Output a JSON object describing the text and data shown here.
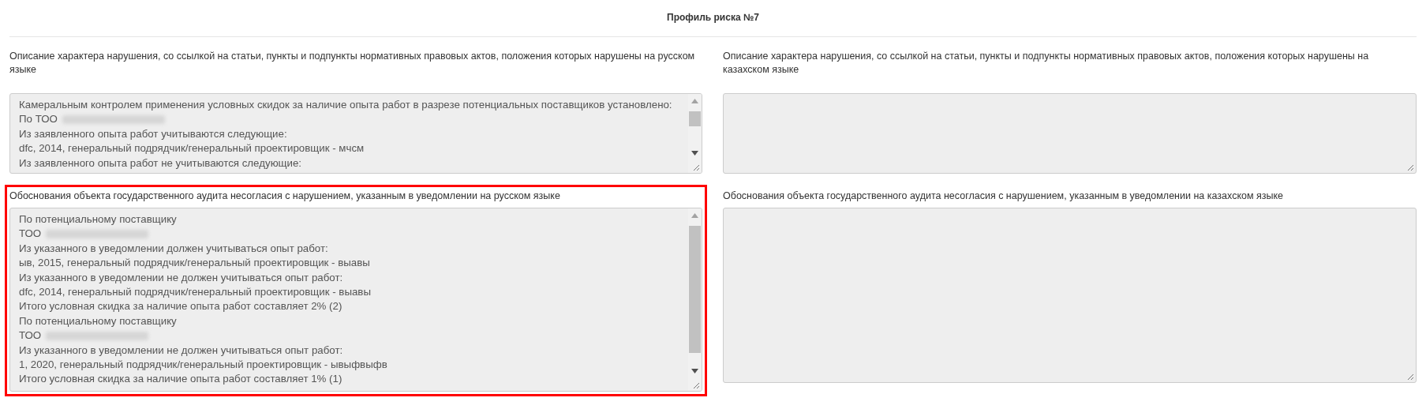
{
  "title": "Профиль риска №7",
  "fields": [
    {
      "label": "Описание характера нарушения, со ссылкой на статьи, пункты и подпункты нормативных правовых актов, положения которых нарушены на русском языке",
      "highlighted": false,
      "lines": [
        {
          "text": "Камеральным контролем применения условных скидок за наличие опыта работ в разрезе потенциальных поставщиков установлено:",
          "redacted": false
        },
        {
          "text": "По ТОО",
          "redacted": true
        },
        {
          "text": "Из заявленного опыта работ учитываются следующие:",
          "redacted": false
        },
        {
          "text": "dfc, 2014, генеральный подрядчик/генеральный проектировщик - мчсм",
          "redacted": false
        },
        {
          "text": "Из заявленного опыта работ не учитываются следующие:",
          "redacted": false
        }
      ]
    },
    {
      "label": "Описание характера нарушения, со ссылкой на статьи, пункты и подпункты нормативных правовых актов, положения которых нарушены на казахском языке",
      "highlighted": false
    },
    {
      "label": "Обоснования объекта государственного аудита несогласия с нарушением, указанным в уведомлении на русском языке",
      "highlighted": true,
      "lines": [
        {
          "text": "По потенциальному поставщику",
          "redacted": false
        },
        {
          "text": "ТОО",
          "redacted": true
        },
        {
          "text": "Из указанного в уведомлении должен учитываться опыт работ:",
          "redacted": false
        },
        {
          "text": "ыв, 2015, генеральный подрядчик/генеральный проектировщик - выавы",
          "redacted": false
        },
        {
          "text": "Из указанного в уведомлении не должен учитываться опыт работ:",
          "redacted": false
        },
        {
          "text": "dfc, 2014, генеральный подрядчик/генеральный проектировщик - выавы",
          "redacted": false
        },
        {
          "text": "Итого условная скидка за наличие опыта работ  составляет 2% (2)",
          "redacted": false
        },
        {
          "text": "По потенциальному поставщику",
          "redacted": false
        },
        {
          "text": "ТОО",
          "redacted": true
        },
        {
          "text": "Из указанного в уведомлении не должен учитываться опыт работ:",
          "redacted": false
        },
        {
          "text": "1, 2020, генеральный подрядчик/генеральный проектировщик - ывыфвыфв",
          "redacted": false
        },
        {
          "text": "Итого условная скидка за наличие опыта работ  составляет 1% (1)",
          "redacted": false
        }
      ]
    },
    {
      "label": "Обоснования объекта государственного аудита несогласия с нарушением, указанным в уведомлении на казахском языке",
      "highlighted": false
    }
  ]
}
